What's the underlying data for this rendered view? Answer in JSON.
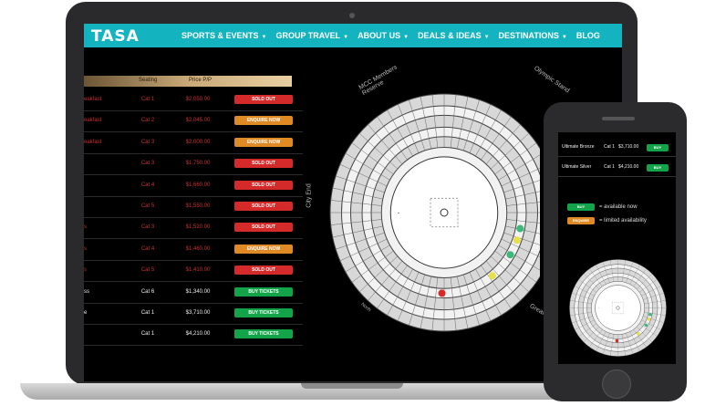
{
  "nav": {
    "logo": "TASA",
    "items": [
      {
        "label": "SPORTS & EVENTS",
        "dropdown": true
      },
      {
        "label": "GROUP TRAVEL",
        "dropdown": true
      },
      {
        "label": "ABOUT US",
        "dropdown": true
      },
      {
        "label": "DEALS & IDEAS",
        "dropdown": true
      },
      {
        "label": "DESTINATIONS",
        "dropdown": true
      },
      {
        "label": "BLOG",
        "dropdown": false
      }
    ]
  },
  "table": {
    "headers": {
      "seating": "Seating",
      "price": "Price P/P"
    },
    "rows": [
      {
        "name": "eakfast",
        "seating": "Cat 1",
        "price": "$2,050.00",
        "action": "SOLD OUT",
        "status": "sold"
      },
      {
        "name": "eakfast",
        "seating": "Cat 2",
        "price": "$2,045.00",
        "action": "ENQUIRE NOW",
        "status": "enquire"
      },
      {
        "name": "eakfast",
        "seating": "Cat 3",
        "price": "$2,000.00",
        "action": "ENQUIRE NOW",
        "status": "enquire"
      },
      {
        "name": "",
        "seating": "Cat 3",
        "price": "$1,750.00",
        "action": "SOLD OUT",
        "status": "sold"
      },
      {
        "name": "",
        "seating": "Cat 4",
        "price": "$1,660.00",
        "action": "SOLD OUT",
        "status": "sold"
      },
      {
        "name": "",
        "seating": "Cat 5",
        "price": "$1,550.00",
        "action": "SOLD OUT",
        "status": "sold"
      },
      {
        "name": "s",
        "seating": "Cat 3",
        "price": "$1,520.00",
        "action": "SOLD OUT",
        "status": "sold"
      },
      {
        "name": "s",
        "seating": "Cat 4",
        "price": "$1,460.00",
        "action": "ENQUIRE NOW",
        "status": "enquire"
      },
      {
        "name": "s",
        "seating": "Cat 5",
        "price": "$1,410.00",
        "action": "SOLD OUT",
        "status": "sold"
      },
      {
        "name": "ss",
        "seating": "Cat 6",
        "price": "$1,340.00",
        "action": "BUY TICKETS",
        "status": "buy"
      },
      {
        "name": "e",
        "seating": "Cat 1",
        "price": "$3,710.00",
        "action": "BUY TICKETS",
        "status": "buy"
      },
      {
        "name": "",
        "seating": "Cat 1",
        "price": "$4,210.00",
        "action": "BUY TICKETS",
        "status": "buy"
      }
    ]
  },
  "stadium": {
    "labels": {
      "members": "MCC Members Reserve",
      "olympic": "Olympic Stand",
      "city_end": "City End",
      "great": "Great",
      "north": "North"
    }
  },
  "phone": {
    "rows": [
      {
        "name": "Ultimate Bronze",
        "seating": "Cat 1",
        "price": "$3,710.00",
        "action": "BUY"
      },
      {
        "name": "Ultimate Silver",
        "seating": "Cat 1",
        "price": "$4,210.00",
        "action": "BUY"
      }
    ],
    "legend": [
      {
        "button": "BUY",
        "text": "= available now",
        "status": "buy"
      },
      {
        "button": "ENQUIRE",
        "text": "= limited availability",
        "status": "enquire"
      }
    ]
  },
  "colors": {
    "nav": "#13b3c0",
    "sold": "#d42a2a",
    "enquire": "#e08a25",
    "buy": "#13a44a",
    "price_red": "#c73030"
  }
}
